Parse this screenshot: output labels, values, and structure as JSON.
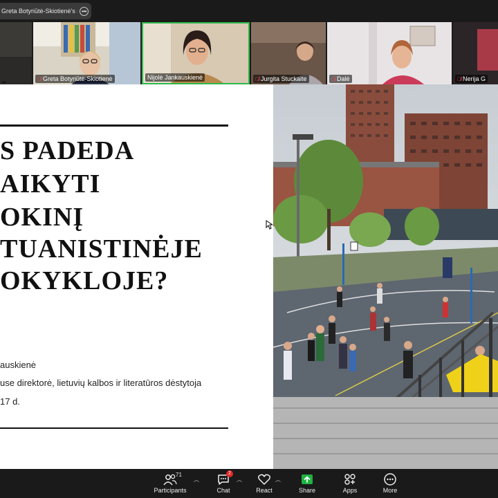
{
  "share_bar": {
    "label": "Greta Botyriūtė-Skiotienė's scree",
    "more_icon": "ellipsis-icon"
  },
  "participants": [
    {
      "name": "",
      "muted": false
    },
    {
      "name": "Greta Botyriūtė-Skiotienė",
      "muted": true
    },
    {
      "name": "Nijolė Jankauskienė",
      "muted": false,
      "active": true
    },
    {
      "name": "Jurgita Stuckaite",
      "muted": true
    },
    {
      "name": "Dalė",
      "muted": true
    },
    {
      "name": "Nerija G",
      "muted": true
    }
  ],
  "slide": {
    "title_lines": [
      "S PADEDA",
      "AIKYTI",
      "OKINĮ",
      "TUANISTINĖJE",
      "OKYKLOJE?"
    ],
    "presenter": "auskienė",
    "role": "use direktorė, lietuvių kalbos ir literatūros dėstytoja",
    "date": "17 d."
  },
  "toolbar": {
    "participants": {
      "label": "Participants",
      "count": "71"
    },
    "chat": {
      "label": "Chat",
      "badge": "2"
    },
    "react": {
      "label": "React"
    },
    "share": {
      "label": "Share"
    },
    "apps": {
      "label": "Apps"
    },
    "more": {
      "label": "More"
    }
  },
  "colors": {
    "active_speaker_border": "#2db84b",
    "share_button": "#1fb141",
    "muted_icon": "#ff4d4d",
    "chat_badge": "#e02828"
  }
}
